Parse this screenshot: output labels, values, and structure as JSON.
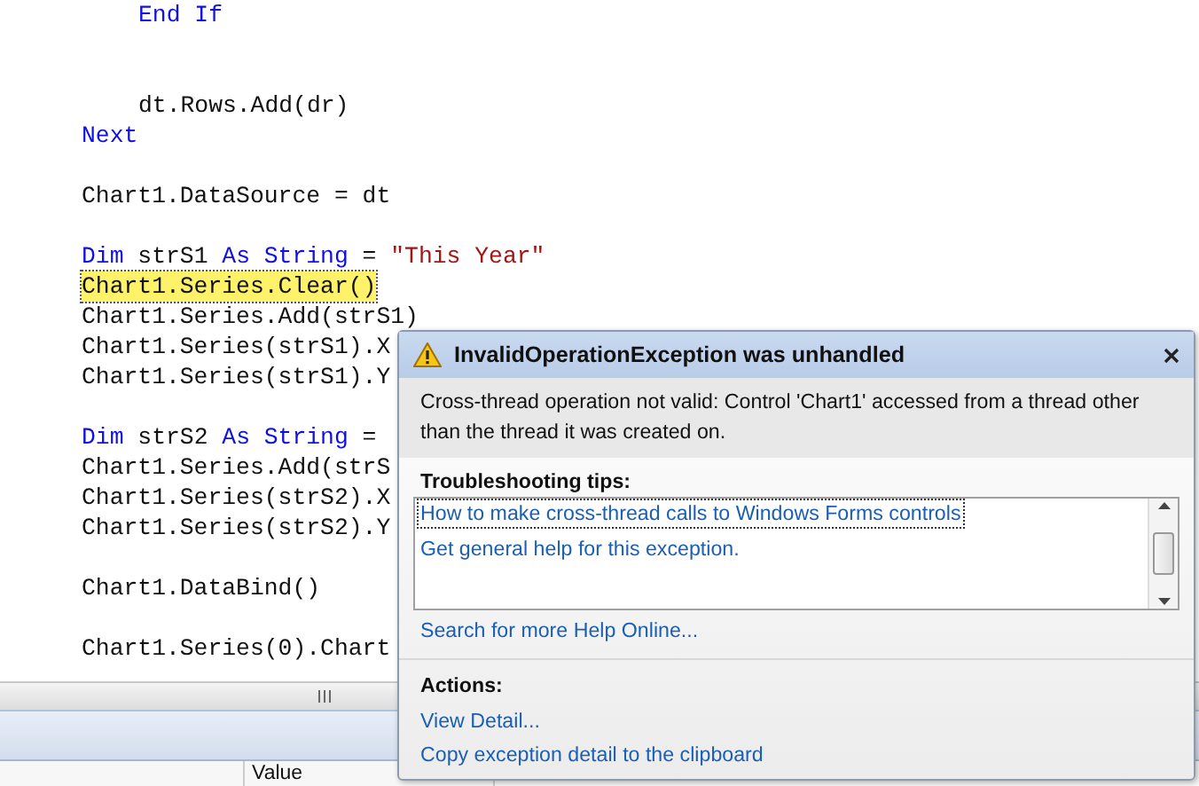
{
  "editor": {
    "lines": [
      {
        "kind": "block",
        "children": [
          {
            "kind": "code",
            "current": false,
            "tokens": [
              {
                "kind": "keyword",
                "text": "End If"
              }
            ]
          },
          {
            "kind": "blank"
          },
          {
            "kind": "blank"
          },
          {
            "kind": "code",
            "current": false,
            "tokens": [
              {
                "kind": "plain",
                "text": "dt.Rows.Add(dr)"
              }
            ]
          }
        ]
      },
      {
        "kind": "code",
        "current": false,
        "tokens": [
          {
            "kind": "keyword",
            "text": "Next"
          }
        ]
      },
      {
        "kind": "blank"
      },
      {
        "kind": "code",
        "current": false,
        "tokens": [
          {
            "kind": "plain",
            "text": "Chart1.DataSource = dt"
          }
        ]
      },
      {
        "kind": "blank"
      },
      {
        "kind": "code",
        "current": false,
        "tokens": [
          {
            "kind": "keyword",
            "text": "Dim"
          },
          {
            "kind": "plain",
            "text": " strS1 "
          },
          {
            "kind": "keyword",
            "text": "As"
          },
          {
            "kind": "keyword",
            "text": " String"
          },
          {
            "kind": "plain",
            "text": " = "
          },
          {
            "kind": "string",
            "text": "\"This Year\""
          }
        ]
      },
      {
        "kind": "code",
        "current": true,
        "tokens": [
          {
            "kind": "plain",
            "text": "Chart1.Series.Clear()"
          }
        ]
      },
      {
        "kind": "code",
        "current": false,
        "tokens": [
          {
            "kind": "plain",
            "text": "Chart1.Series.Add(strS1)"
          }
        ]
      },
      {
        "kind": "code",
        "current": false,
        "tokens": [
          {
            "kind": "plain",
            "text": "Chart1.Series(strS1).X"
          }
        ]
      },
      {
        "kind": "code",
        "current": false,
        "tokens": [
          {
            "kind": "plain",
            "text": "Chart1.Series(strS1).Y"
          }
        ]
      },
      {
        "kind": "blank"
      },
      {
        "kind": "code",
        "current": false,
        "tokens": [
          {
            "kind": "keyword",
            "text": "Dim"
          },
          {
            "kind": "plain",
            "text": " strS2 "
          },
          {
            "kind": "keyword",
            "text": "As"
          },
          {
            "kind": "keyword",
            "text": " String"
          },
          {
            "kind": "plain",
            "text": " ="
          }
        ]
      },
      {
        "kind": "code",
        "current": false,
        "tokens": [
          {
            "kind": "plain",
            "text": "Chart1.Series.Add(strS"
          }
        ]
      },
      {
        "kind": "code",
        "current": false,
        "tokens": [
          {
            "kind": "plain",
            "text": "Chart1.Series(strS2).X"
          }
        ]
      },
      {
        "kind": "code",
        "current": false,
        "tokens": [
          {
            "kind": "plain",
            "text": "Chart1.Series(strS2).Y"
          }
        ]
      },
      {
        "kind": "blank"
      },
      {
        "kind": "code",
        "current": false,
        "tokens": [
          {
            "kind": "plain",
            "text": "Chart1.DataBind()"
          }
        ]
      },
      {
        "kind": "blank"
      },
      {
        "kind": "code",
        "current": false,
        "tokens": [
          {
            "kind": "plain",
            "text": "Chart1.Series(0).Chart"
          }
        ]
      }
    ]
  },
  "exception_dialog": {
    "title": "InvalidOperationException was unhandled",
    "message": "Cross-thread operation not valid: Control 'Chart1' accessed from a thread other than the thread it was created on.",
    "tips_heading": "Troubleshooting tips:",
    "tips": [
      {
        "text": "How to make cross-thread calls to Windows Forms controls",
        "focused": true
      },
      {
        "text": "Get general help for this exception.",
        "focused": false
      }
    ],
    "search_link": "Search for more Help Online...",
    "actions_heading": "Actions:",
    "actions": [
      "View Detail...",
      "Copy exception detail to the clipboard"
    ]
  },
  "bottom_panel": {
    "columns": [
      "Value"
    ]
  }
}
